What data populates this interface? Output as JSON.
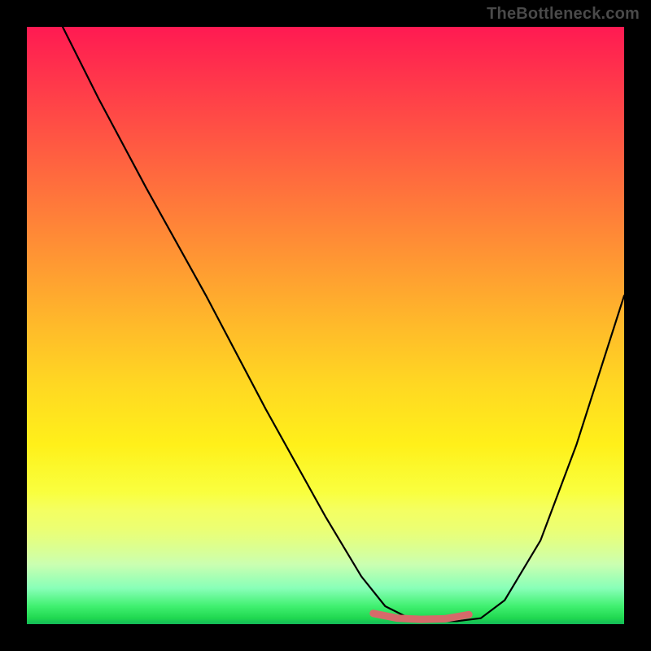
{
  "watermark": "TheBottleneck.com",
  "chart_data": {
    "type": "line",
    "title": "",
    "xlabel": "",
    "ylabel": "",
    "xlim": [
      0,
      100
    ],
    "ylim": [
      0,
      100
    ],
    "grid": false,
    "legend": false,
    "background": "red-yellow-green vertical gradient",
    "series": [
      {
        "name": "bottleneck-curve",
        "color": "#000000",
        "width": 2.2,
        "x": [
          6,
          12,
          20,
          30,
          40,
          50,
          56,
          60,
          64,
          68,
          72,
          76,
          80,
          86,
          92,
          100
        ],
        "y": [
          100,
          88,
          73,
          55,
          36,
          18,
          8,
          3,
          1,
          0.5,
          0.5,
          1,
          4,
          14,
          30,
          55
        ]
      },
      {
        "name": "valley-marker",
        "color": "#d66a6a",
        "width": 9,
        "cap": "round",
        "x": [
          58,
          62,
          66,
          70,
          74
        ],
        "y": [
          1.8,
          1.0,
          0.8,
          0.9,
          1.6
        ]
      }
    ]
  }
}
